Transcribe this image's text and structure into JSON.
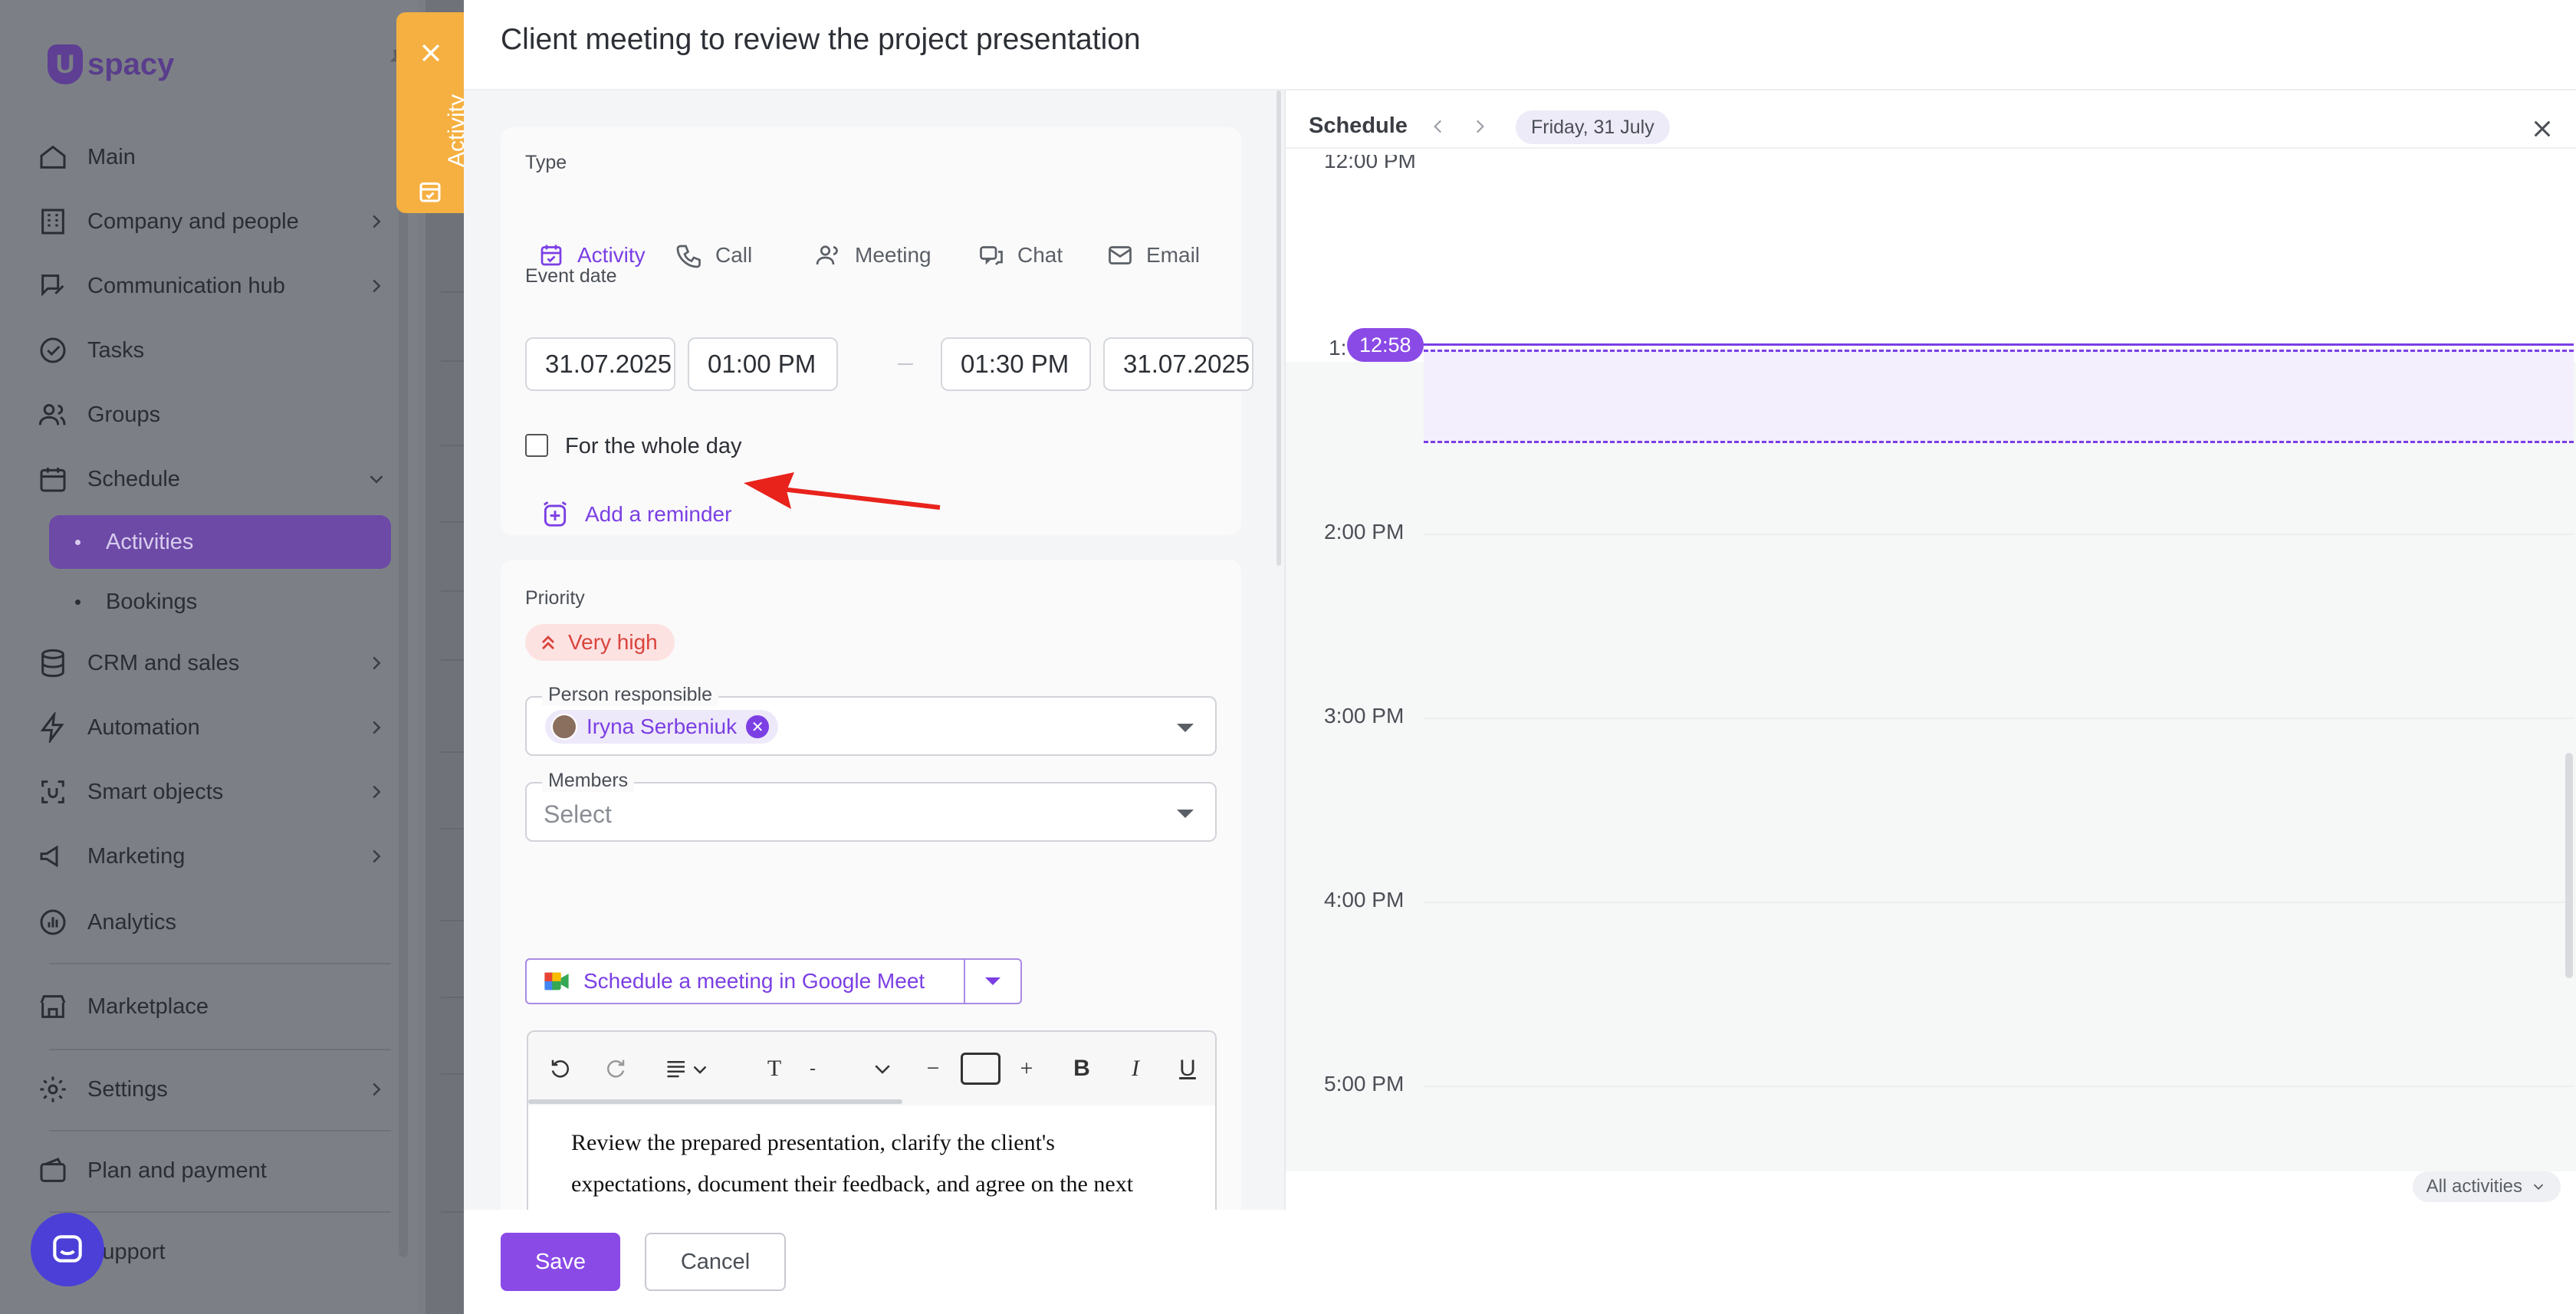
{
  "sidebar": {
    "logo": "spacy",
    "items": [
      {
        "label": "Main"
      },
      {
        "label": "Company and people"
      },
      {
        "label": "Communication hub"
      },
      {
        "label": "Tasks"
      },
      {
        "label": "Groups"
      },
      {
        "label": "Schedule"
      },
      {
        "label": "Activities"
      },
      {
        "label": "Bookings"
      },
      {
        "label": "CRM and sales"
      },
      {
        "label": "Automation"
      },
      {
        "label": "Smart objects"
      },
      {
        "label": "Marketing"
      },
      {
        "label": "Analytics"
      },
      {
        "label": "Marketplace"
      },
      {
        "label": "Settings"
      },
      {
        "label": "Plan and payment"
      },
      {
        "label": "Support"
      }
    ]
  },
  "activity_tab": {
    "label": "Activity"
  },
  "panel": {
    "title": "Client meeting to review the project presentation"
  },
  "form": {
    "type_label": "Type",
    "types": [
      {
        "label": "Activity",
        "icon": "calendar-check-icon",
        "active": true
      },
      {
        "label": "Call",
        "icon": "phone-icon"
      },
      {
        "label": "Meeting",
        "icon": "people-icon"
      },
      {
        "label": "Chat",
        "icon": "chat-icon"
      },
      {
        "label": "Email",
        "icon": "mail-icon"
      }
    ],
    "event_date_label": "Event date",
    "start_date": "31.07.2025",
    "start_time": "01:00 PM",
    "end_time": "01:30 PM",
    "end_date": "31.07.2025",
    "whole_day_label": "For the whole day",
    "reminder_label": "Add a reminder",
    "priority_label": "Priority",
    "priority_value": "Very high",
    "person_label": "Person responsible",
    "person_name": "Iryna Serbeniuk",
    "members_label": "Members",
    "members_placeholder": "Select",
    "gmeet_label": "Schedule a meeting in Google Meet",
    "toolbar_font_size": "-",
    "description": "Review the prepared presentation, clarify the client's expectations, document their feedback, and agree on the next steps."
  },
  "footer": {
    "save": "Save",
    "cancel": "Cancel"
  },
  "schedule": {
    "title": "Schedule",
    "date": "Friday, 31 July",
    "hours": {
      "h12": "12:00 PM",
      "h1": "1:",
      "h2": "2:00 PM",
      "h3": "3:00 PM",
      "h4": "4:00 PM",
      "h5": "5:00 PM"
    },
    "now": "12:58",
    "all_activities": "All activities"
  },
  "colors": {
    "accent": "#7b3fe4",
    "tab": "#f5b041",
    "priority": "#d9443c"
  }
}
